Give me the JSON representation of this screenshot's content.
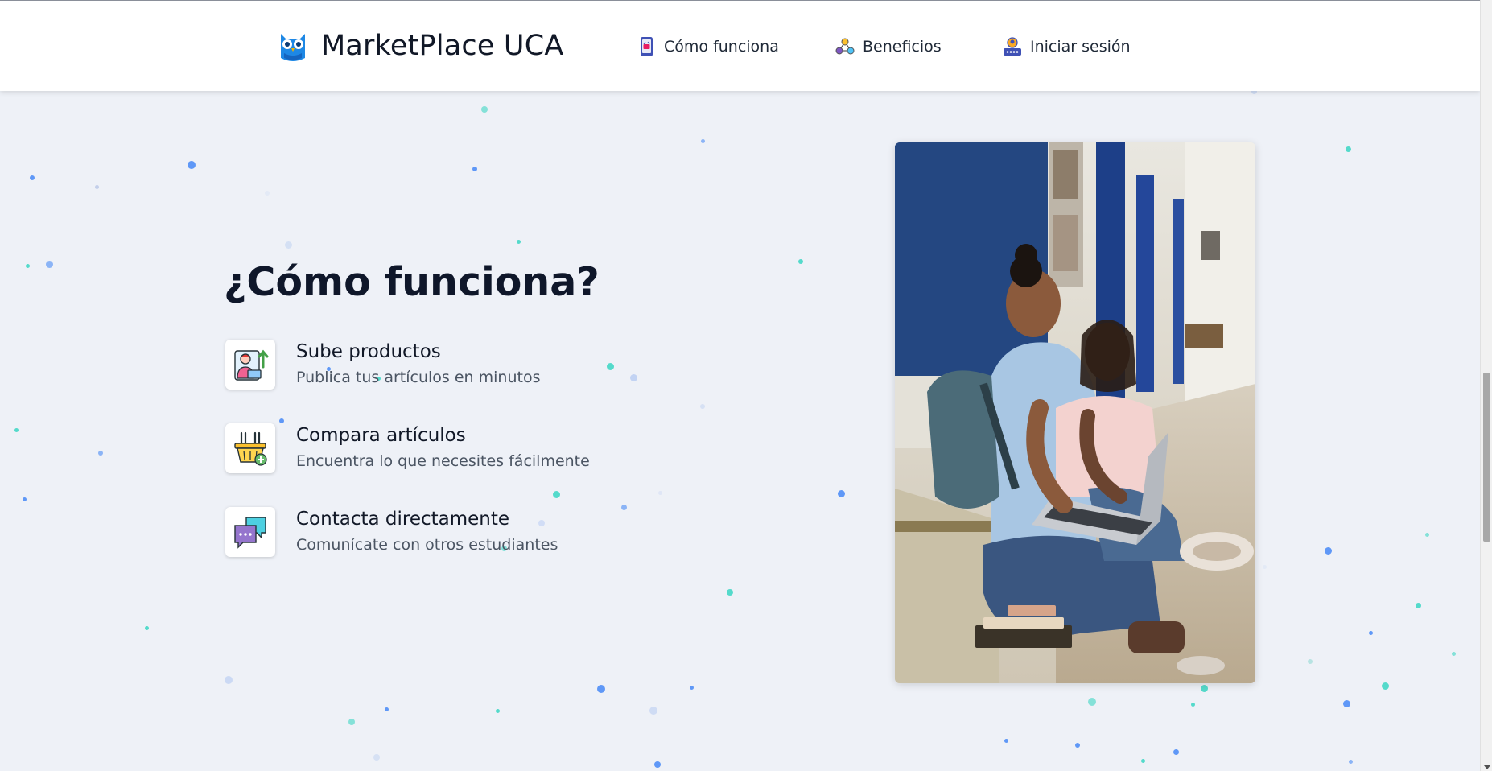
{
  "header": {
    "brand_name": "MarketPlace UCA",
    "nav": [
      {
        "label": "Cómo funciona",
        "icon": "phone-basket-icon"
      },
      {
        "label": "Beneficios",
        "icon": "network-nodes-icon"
      },
      {
        "label": "Iniciar sesión",
        "icon": "user-login-icon"
      }
    ]
  },
  "main": {
    "title": "¿Cómo funciona?",
    "features": [
      {
        "title": "Sube productos",
        "description": "Publica tus artículos en minutos",
        "icon": "upload-user-icon"
      },
      {
        "title": "Compara artículos",
        "description": "Encuentra lo que necesites fácilmente",
        "icon": "basket-add-icon"
      },
      {
        "title": "Contacta directamente",
        "description": "Comunícate con otros estudiantes",
        "icon": "chat-bubbles-icon"
      }
    ],
    "image": {
      "alt": "students-with-laptop-photo"
    }
  },
  "colors": {
    "background": "#eef1f7",
    "header_bg": "#ffffff",
    "title_text": "#0f172a",
    "body_text": "#4b5563",
    "brand_blue": "#1e88e5",
    "particle_blue": "#3b82f6",
    "particle_teal": "#2dd4bf"
  }
}
